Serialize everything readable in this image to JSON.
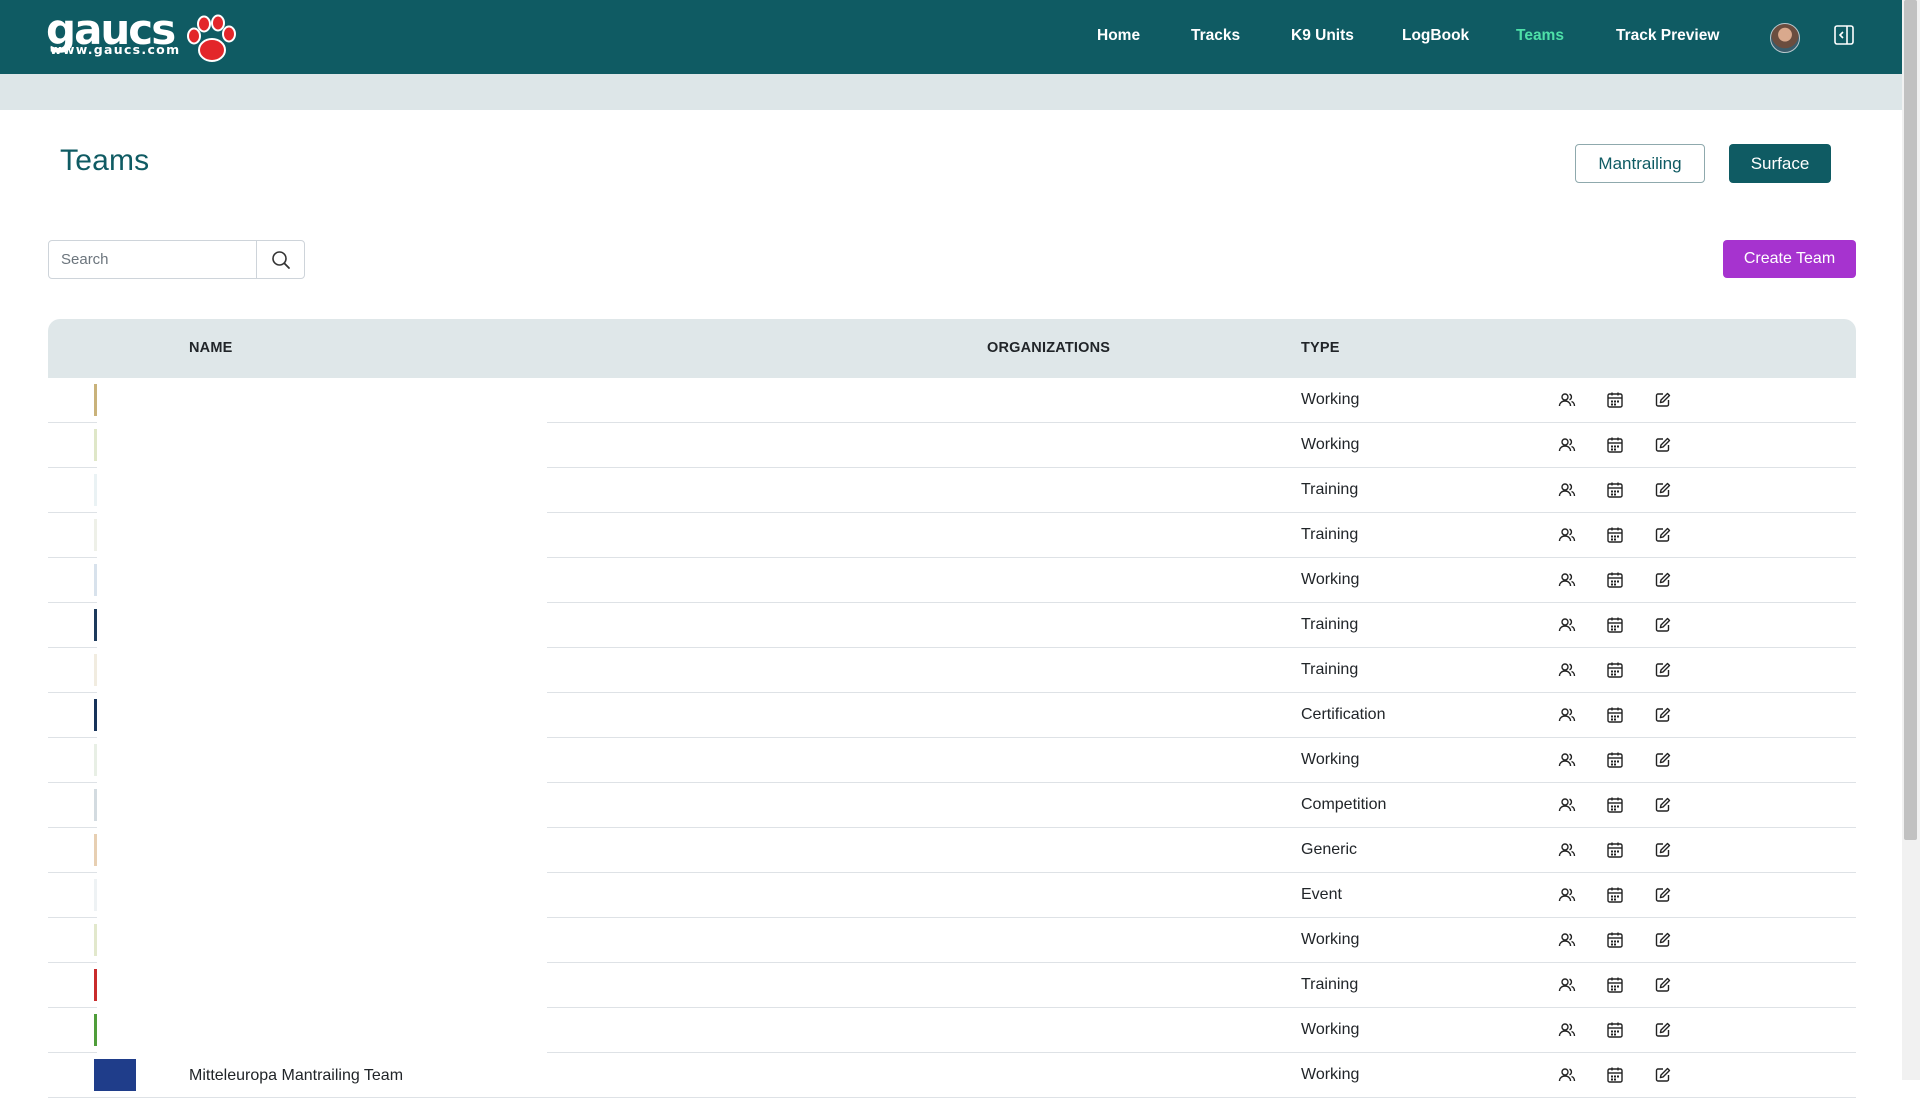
{
  "brand": {
    "word": "gaucs",
    "url": "www.gaucs.com",
    "paw_color": "#e3262a"
  },
  "nav": {
    "links": [
      {
        "label": "Home",
        "active": false
      },
      {
        "label": "Tracks",
        "active": false
      },
      {
        "label": "K9 Units",
        "active": false
      },
      {
        "label": "LogBook",
        "active": false
      },
      {
        "label": "Teams",
        "active": true
      },
      {
        "label": "Track Preview",
        "active": false
      }
    ],
    "avatar_icon": "user-avatar",
    "collapse_icon": "sidebar-collapse-icon"
  },
  "page": {
    "title": "Teams"
  },
  "mode_toggle": {
    "mantrailing_label": "Mantrailing",
    "surface_label": "Surface",
    "active": "Surface"
  },
  "search": {
    "placeholder": "Search",
    "value": "",
    "icon": "search-icon"
  },
  "create_button": {
    "label": "Create Team"
  },
  "table": {
    "headers": {
      "name": "NAME",
      "organizations": "ORGANIZATIONS",
      "type": "TYPE"
    },
    "row_icons": [
      "members-icon",
      "calendar-icon",
      "edit-icon"
    ],
    "rows": [
      {
        "name": "",
        "organizations": "",
        "type": "Working"
      },
      {
        "name": "",
        "organizations": "",
        "type": "Working"
      },
      {
        "name": "",
        "organizations": "",
        "type": "Training"
      },
      {
        "name": "",
        "organizations": "",
        "type": "Training"
      },
      {
        "name": "",
        "organizations": "",
        "type": "Working"
      },
      {
        "name": "",
        "organizations": "",
        "type": "Training"
      },
      {
        "name": "",
        "organizations": "",
        "type": "Training"
      },
      {
        "name": "",
        "organizations": "",
        "type": "Certification"
      },
      {
        "name": "",
        "organizations": "",
        "type": "Working"
      },
      {
        "name": "",
        "organizations": "",
        "type": "Competition"
      },
      {
        "name": "",
        "organizations": "",
        "type": "Generic"
      },
      {
        "name": "",
        "organizations": "",
        "type": "Event"
      },
      {
        "name": "",
        "organizations": "",
        "type": "Working"
      },
      {
        "name": "",
        "organizations": "",
        "type": "Training"
      },
      {
        "name": "",
        "organizations": "",
        "type": "Working"
      },
      {
        "name": "Mitteleuropa Mantrailing Team",
        "organizations": "",
        "type": "Working"
      }
    ]
  },
  "colors": {
    "primary": "#0f5b63",
    "accent_purple": "#a633cf",
    "active_nav": "#4ee0a8",
    "header_bg": "#dfe7e9"
  }
}
